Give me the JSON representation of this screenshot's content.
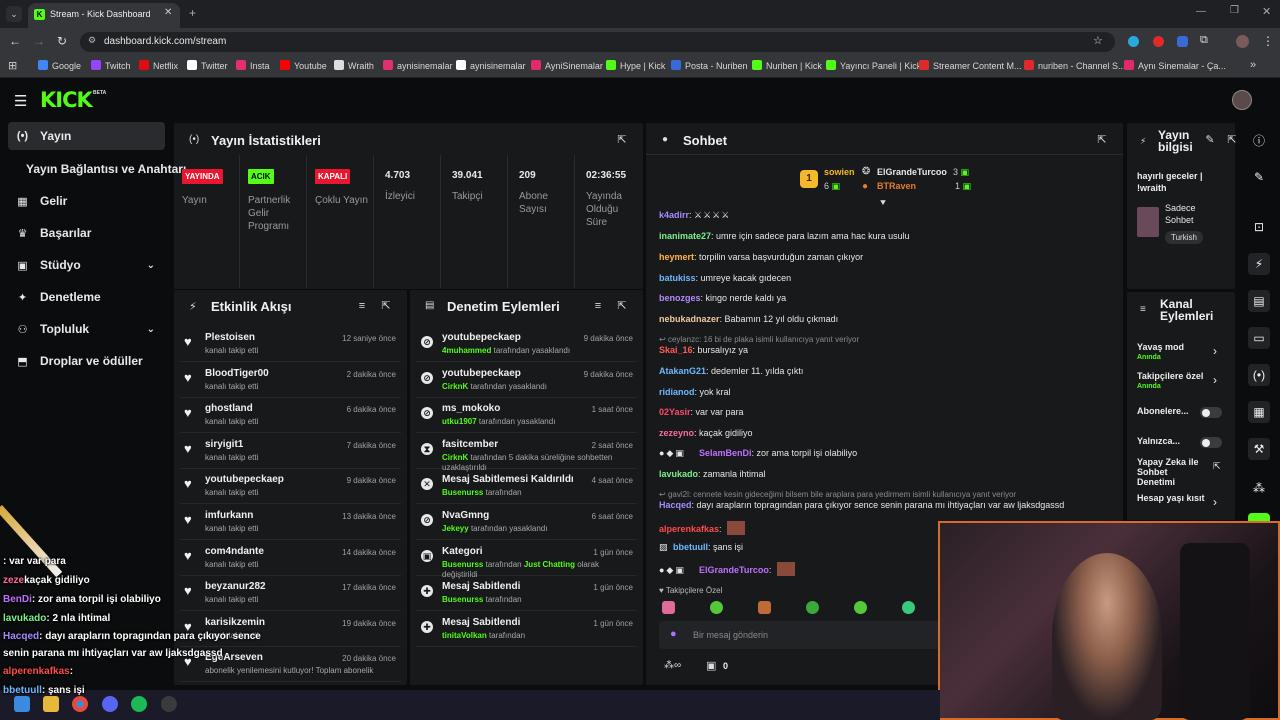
{
  "browser": {
    "tab_title": "Stream - Kick Dashboard",
    "url": "dashboard.kick.com/stream",
    "bookmarks": [
      "Google",
      "Twitch",
      "Netflix",
      "Twitter",
      "Insta",
      "Youtube",
      "Wraith",
      "aynisinemalar",
      "aynisinemalar",
      "AyniSinemalar",
      "Hype | Kick",
      "Posta - Nuriben",
      "Nuriben | Kick",
      "Yayıncı Paneli | Kick",
      "Streamer Content M...",
      "nuriben - Channel S...",
      "Aynı Sinemalar - Ça..."
    ]
  },
  "site": {
    "logo": "KICK",
    "beta": "BETA"
  },
  "sidebar": {
    "items": [
      {
        "label": "Yayın",
        "icon": "broadcast-icon",
        "active": true
      },
      {
        "label": "Yayın Bağlantısı ve Anahtarı",
        "icon": "",
        "active": false
      },
      {
        "label": "Gelir",
        "icon": "revenue-icon",
        "active": false
      },
      {
        "label": "Başarılar",
        "icon": "trophy-icon",
        "active": false
      },
      {
        "label": "Stüdyo",
        "icon": "studio-icon",
        "active": false,
        "chevron": true
      },
      {
        "label": "Denetleme",
        "icon": "wrench-icon",
        "active": false
      },
      {
        "label": "Topluluk",
        "icon": "community-icon",
        "active": false,
        "chevron": true
      },
      {
        "label": "Droplar ve ödüller",
        "icon": "drops-icon",
        "active": false
      }
    ]
  },
  "stats": {
    "title": "Yayın İstatistikleri",
    "badges": [
      {
        "text": "YAYINDA",
        "label": "Yayın",
        "color": "#e8162f"
      },
      {
        "text": "ACIK",
        "label": "Partnerlik Gelir Programı",
        "color": "#53fc18"
      },
      {
        "text": "KAPALI",
        "label": "Çoklu Yayın",
        "color": "#e8162f"
      }
    ],
    "values": [
      {
        "value": "4.703",
        "label": "İzleyici"
      },
      {
        "value": "39.041",
        "label": "Takipçi"
      },
      {
        "value": "209",
        "label": "Abone Sayısı"
      },
      {
        "value": "02:36:55",
        "label": "Yayında Olduğu Süre"
      }
    ]
  },
  "activity": {
    "title": "Etkinlik Akışı",
    "items": [
      {
        "name": "Plestoisen",
        "sub": "kanalı takip etti",
        "time": "12 saniye önce"
      },
      {
        "name": "BloodTiger00",
        "sub": "kanalı takip etti",
        "time": "2 dakika önce"
      },
      {
        "name": "ghostland",
        "sub": "kanalı takip etti",
        "time": "6 dakika önce"
      },
      {
        "name": "siryigit1",
        "sub": "kanalı takip etti",
        "time": "7 dakika önce"
      },
      {
        "name": "youtubepeckaep",
        "sub": "kanalı takip etti",
        "time": "9 dakika önce"
      },
      {
        "name": "imfurkann",
        "sub": "kanalı takip etti",
        "time": "13 dakika önce"
      },
      {
        "name": "com4ndante",
        "sub": "kanalı takip etti",
        "time": "14 dakika önce"
      },
      {
        "name": "beyzanur282",
        "sub": "kanalı takip etti",
        "time": "17 dakika önce"
      },
      {
        "name": "karisikzemin",
        "sub": "kanalı takip etti",
        "time": "19 dakika önce"
      },
      {
        "name": "EgeArseven",
        "sub": "abonelik yenilemesini kutluyor! Toplam abonelik",
        "time": "20 dakika önce"
      }
    ]
  },
  "moderation": {
    "title": "Denetim Eylemleri",
    "items": [
      {
        "name": "youtubepeckaep",
        "mod": "4muhammed",
        "sub": "tarafından yasaklandı",
        "time": "9 dakika önce"
      },
      {
        "name": "youtubepeckaep",
        "mod": "CirknK",
        "sub": "tarafından yasaklandı",
        "time": "9 dakika önce"
      },
      {
        "name": "ms_mokoko",
        "mod": "utku1907",
        "sub": "tarafından yasaklandı",
        "time": "1 saat önce"
      },
      {
        "name": "fasitcember",
        "mod": "CirknK",
        "sub": "tarafından 5 dakika süreliğine sohbetten",
        "sub2": "uzaklaştırıldı",
        "time": "2 saat önce"
      },
      {
        "name": "Mesaj Sabitlemesi Kaldırıldı",
        "mod": "Busenurss",
        "sub": "tarafından",
        "time": "4 saat önce"
      },
      {
        "name": "NvaGmng",
        "mod": "Jekeyy",
        "sub": "tarafından yasaklandı",
        "time": "6 saat önce"
      },
      {
        "name": "Kategori",
        "mod": "Busenurss",
        "sub": "tarafından",
        "extra": "Just Chatting",
        "sub3": "olarak",
        "sub2": "değiştirildi",
        "time": "1 gün önce"
      },
      {
        "name": "Mesaj Sabitlendi",
        "mod": "Busenurss",
        "sub": "tarafından",
        "time": "1 gün önce"
      },
      {
        "name": "Mesaj Sabitlendi",
        "mod": "tinitaVolkan",
        "sub": "tarafından",
        "time": "1 gün önce"
      }
    ]
  },
  "chat": {
    "title": "Sohbet",
    "top": [
      {
        "name": "sowien",
        "count": "6"
      },
      {
        "name": "ElGrandeTurcoo",
        "count": "3"
      },
      {
        "name": "BTRaven",
        "count": "1"
      }
    ],
    "rank": "1",
    "messages": [
      {
        "user": "k4adirr",
        "color": "#a58cff",
        "text": ""
      },
      {
        "user": "inanimate27",
        "color": "#7cf08a",
        "text": "umre için sadece para lazım ama hac kura usulu"
      },
      {
        "user": "heymert",
        "color": "#ffb44a",
        "text": "torpilin varsa başvurduğun zaman çıkıyor"
      },
      {
        "user": "batukiss",
        "color": "#6fb8ff",
        "text": "umreye kacak gıdecen"
      },
      {
        "user": "benozges",
        "color": "#b28aff",
        "text": "kingo nerde kaldı ya"
      },
      {
        "user": "nebukadnazer",
        "color": "#f0c8a0",
        "text": "Babamın 12 yıl oldu çıkmadı"
      },
      {
        "reply": "ceylanzc: 16 bi de plaka isimli kullanıcıya yanıt veriyor"
      },
      {
        "user": "Skai_16",
        "color": "#ff5a5a",
        "text": "bursalıyız ya"
      },
      {
        "user": "AtakanG21",
        "color": "#6fb8ff",
        "text": "dedemler 11. yılda çıktı"
      },
      {
        "user": "ridianod",
        "color": "#6fb8ff",
        "text": "yok kral"
      },
      {
        "user": "02Yasir",
        "color": "#ff4a6a",
        "text": "var var para"
      },
      {
        "user": "zezeyno",
        "color": "#ff6aa0",
        "text": "kaçak gidiliyo"
      },
      {
        "user": "SelamBenDi",
        "color": "#c070ff",
        "text": "zor ama torpil işi olabiliyo"
      },
      {
        "user": "lavukado",
        "color": "#7cf08a",
        "text": "zamanla ihtimal"
      },
      {
        "reply": "gavi2l: cennete kesin gideceğimi bilsem bile araplara para yedirmem isimli kullanıcıya yanıt veriyor"
      },
      {
        "user": "Hacqed",
        "color": "#a58cff",
        "text": "dayı arapların topragından para çıkıyor sence senin parana mı ihtiyaçları var aw ljaksdgassd"
      },
      {
        "user": "alperenkafkas",
        "color": "#ff4a4a",
        "text": ""
      },
      {
        "user": "bbetuull",
        "color": "#6fb8ff",
        "text": "şans işi"
      },
      {
        "user": "ElGrandeTurcoo",
        "color": "#c070ff",
        "text": ""
      }
    ],
    "followers_only": "Takipçilere Özel",
    "input_placeholder": "Bir mesaj gönderin",
    "points": "0"
  },
  "stream_info": {
    "title": "Yayın bilgisi",
    "text": "hayırlı geceler | !wraith",
    "category": "Sadece Sohbet",
    "language": "Turkish"
  },
  "channel_actions": {
    "title": "Kanal Eylemleri",
    "items": [
      {
        "label": "Yavaş mod",
        "status": "Anında",
        "type": "chevron"
      },
      {
        "label": "Takipçilere özel",
        "status": "Anında",
        "type": "chevron"
      },
      {
        "label": "Abonelere...",
        "type": "toggle"
      },
      {
        "label": "Yalnızca...",
        "type": "toggle"
      },
      {
        "label": "Yapay Zeka ile Sohbet Denetimi",
        "type": "external"
      },
      {
        "label": "Hesap yaşı kısıt",
        "type": "chevron"
      }
    ]
  },
  "overlay_chat": [
    {
      "user": "",
      "text": ": var var para",
      "color": "#ff4a6a"
    },
    {
      "user": "zeze",
      "text": "kaçak gidiliyo",
      "color": "#ff6aa0"
    },
    {
      "user": "BenDi",
      "text": ": zor ama torpil işi olabiliyo",
      "color": "#c070ff"
    },
    {
      "user": "lavukado",
      "text": ": 2  nla ihtimal",
      "color": "#7cf08a"
    },
    {
      "user": "Hacqed",
      "text": ": dayı arapların topragından para çıkıyor sence",
      "color": "#a58cff"
    },
    {
      "user": "",
      "text": "senin parana mı ihtiyaçları var aw ljaksdgassd",
      "color": "#ffffff"
    },
    {
      "user": "alperenkafkas",
      "text": ":",
      "color": "#ff4a4a"
    },
    {
      "user": "bbetuull",
      "text": ": şans işi",
      "color": "#6fb8ff"
    }
  ],
  "colors": {
    "accent": "#53fc18",
    "live": "#e8162f",
    "panel": "#18191b",
    "bg": "#0b0c0d"
  }
}
